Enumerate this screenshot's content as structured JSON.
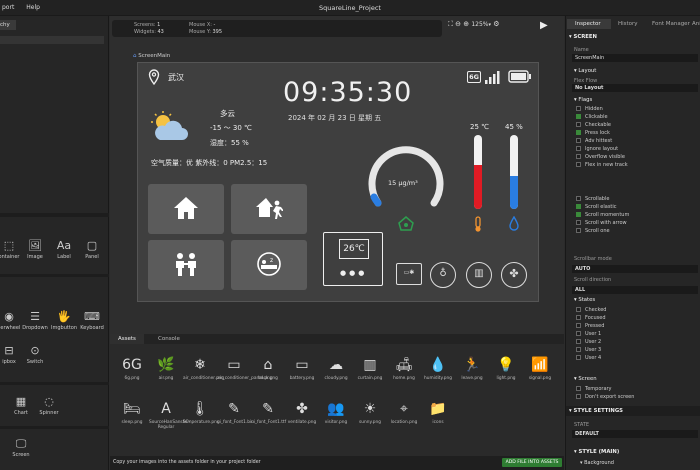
{
  "menu": [
    "port",
    "Help"
  ],
  "window_title": "SquareLine_Project",
  "hierarchy_tab": "chy",
  "widgets_row1": [
    "ontainer",
    "Image",
    "Label",
    "Panel"
  ],
  "widgets_row2": [
    "llerwheel",
    "Dropdown",
    "Imgbutton",
    "Keyboard"
  ],
  "widgets_row3": [
    "ipbox",
    "Switch"
  ],
  "widgets_row4": [
    "Chart",
    "Spinner"
  ],
  "widgets_row5": [
    "Screen"
  ],
  "info": {
    "screens_label": "Screens:",
    "screens": "1",
    "widgets_label": "Widgets:",
    "widgets": "43",
    "mousex_label": "Mouse X:",
    "mousex": "-",
    "mousey_label": "Mouse Y:",
    "mousey": "395"
  },
  "zoom": "125%",
  "screen_label": "ScreenMain",
  "weather": {
    "city": "武汉",
    "condition": "多云",
    "temp": "-15 ～ 30 ℃",
    "humidity": "湿度：55 %",
    "air": "空气质量：优  紫外线：0  PM2.5：15"
  },
  "time": "09:35:30",
  "date": "2024 年 02 月 23 日   星期 五",
  "gauge": "15 μg/m³",
  "temp_bar": {
    "label": "25 ℃",
    "fill": 0.6
  },
  "hum_bar": {
    "label": "45 %",
    "fill": 0.45
  },
  "thermostat": "26℃",
  "assets_tabs": [
    "Assets",
    "Console"
  ],
  "assets_row1": [
    "6g.png",
    "air.png",
    "air_conditioner.png",
    "air_conditioner_panel.png",
    "back.png",
    "battery.png",
    "cloudy.png",
    "curtain.png",
    "home.png",
    "humidity.png",
    "leave.png",
    "light.png",
    "signal.png"
  ],
  "assets_row2": [
    "sleep.png",
    "SourceHanSansSC-Regular",
    "temperature.png",
    "ui_font_Font1.bin",
    "ui_font_Font1.ttf",
    "ventilate.png",
    "visitor.png",
    "sunny.png",
    "location.png",
    "icons"
  ],
  "assets_footer": "Copy your images into the assets folder in your project folder",
  "add_button": "ADD FILE INTO ASSETS",
  "inspector": {
    "tabs": [
      "Inspector",
      "History",
      "Font Manager",
      "Anim"
    ],
    "screen_section": "SCREEN",
    "name_label": "Name",
    "name_value": "ScreenMain",
    "layout_section": "Layout",
    "flex_flow_label": "Flex Flow",
    "flex_flow_value": "No Layout",
    "flags_section": "Flags",
    "flags": [
      {
        "label": "Hidden",
        "on": false
      },
      {
        "label": "Clickable",
        "on": true
      },
      {
        "label": "Checkable",
        "on": false
      },
      {
        "label": "Press lock",
        "on": true
      },
      {
        "label": "Adv hittest",
        "on": false
      },
      {
        "label": "Ignore layout",
        "on": false
      },
      {
        "label": "Overflow visible",
        "on": false
      },
      {
        "label": "Flex in new track",
        "on": false
      }
    ],
    "scroll_flags": [
      {
        "label": "Scrollable",
        "on": false
      },
      {
        "label": "Scroll elastic",
        "on": true
      },
      {
        "label": "Scroll momentum",
        "on": true
      },
      {
        "label": "Scroll with arrow",
        "on": false
      },
      {
        "label": "Scroll one",
        "on": false
      }
    ],
    "scrollbar_mode_label": "Scrollbar mode",
    "scrollbar_mode_value": "AUTO",
    "scroll_dir_label": "Scroll direction",
    "scroll_dir_value": "ALL",
    "states_section": "States",
    "states": [
      "Checked",
      "Focused",
      "Pressed",
      "User 1",
      "User 2",
      "User 3",
      "User 4"
    ],
    "screen_sub": "Screen",
    "screen_opts": [
      "Temporary",
      "Don't export screen"
    ],
    "style_settings": "STYLE SETTINGS",
    "state_label": "STATE",
    "state_value": "DEFAULT",
    "style_main": "STYLE (MAIN)",
    "background": "Background"
  }
}
